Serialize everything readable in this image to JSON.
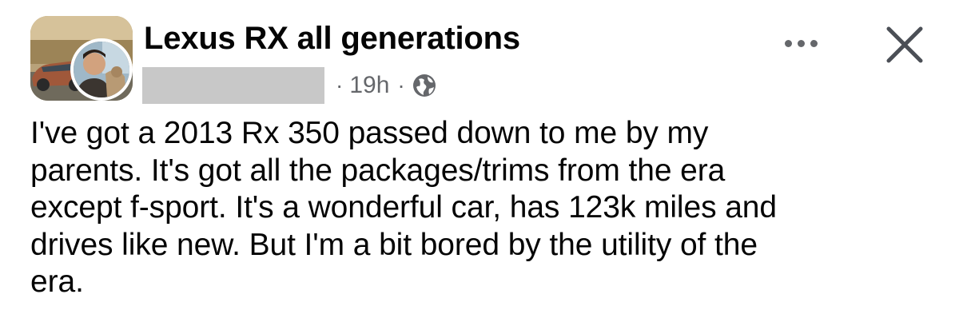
{
  "post": {
    "group_name": "Lexus RX all generations",
    "timestamp": "19h",
    "separator": "·",
    "privacy_icon": "globe-icon",
    "more_icon": "more-options-icon",
    "close_icon": "close-icon",
    "body_lines": [
      "I've got a 2013 Rx 350 passed down to me by my",
      "parents. It's got all the packages/trims from the era",
      "except f-sport. It's a wonderful car, has 123k miles and",
      "drives like new. But I'm a bit bored by the utility of the",
      "era."
    ]
  },
  "colors": {
    "text": "#050505",
    "secondary_text": "#65676b",
    "redaction": "#c8c8c8",
    "background": "#ffffff"
  }
}
